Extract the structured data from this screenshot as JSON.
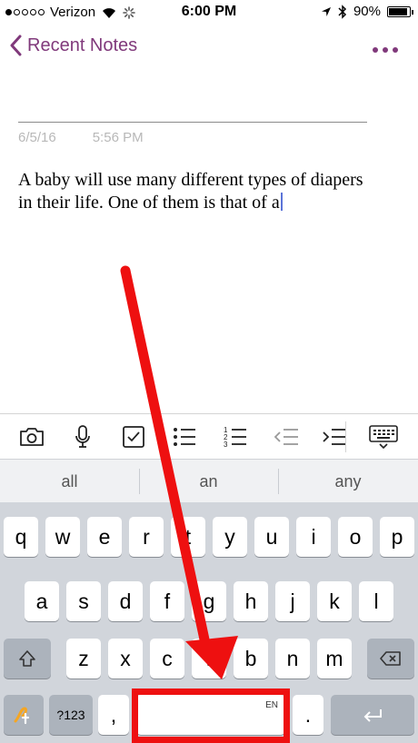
{
  "status_bar": {
    "carrier": "Verizon",
    "time": "6:00 PM",
    "battery": "90%",
    "battery_level": 0.9
  },
  "nav": {
    "back_label": "Recent Notes"
  },
  "note": {
    "date": "6/5/16",
    "time": "5:56 PM",
    "body": "A baby will use many different types of diapers in their life. One of them is that of a"
  },
  "toolbar": {
    "icons": [
      "camera-icon",
      "microphone-icon",
      "checkbox-icon",
      "bullet-list-icon",
      "numbered-list-icon",
      "outdent-icon",
      "indent-icon",
      "keyboard-dismiss-icon"
    ]
  },
  "predictive": [
    "all",
    "an",
    "any"
  ],
  "keyboard": {
    "row1": [
      "q",
      "w",
      "e",
      "r",
      "t",
      "y",
      "u",
      "i",
      "o",
      "p"
    ],
    "row2": [
      "a",
      "s",
      "d",
      "f",
      "g",
      "h",
      "j",
      "k",
      "l"
    ],
    "row3": [
      "z",
      "x",
      "c",
      "v",
      "b",
      "n",
      "m"
    ],
    "numbers_label": "?123",
    "comma": ",",
    "period": ".",
    "space_lang": "EN"
  },
  "colors": {
    "accent": "#80397b",
    "annotation": "#ee1010"
  }
}
